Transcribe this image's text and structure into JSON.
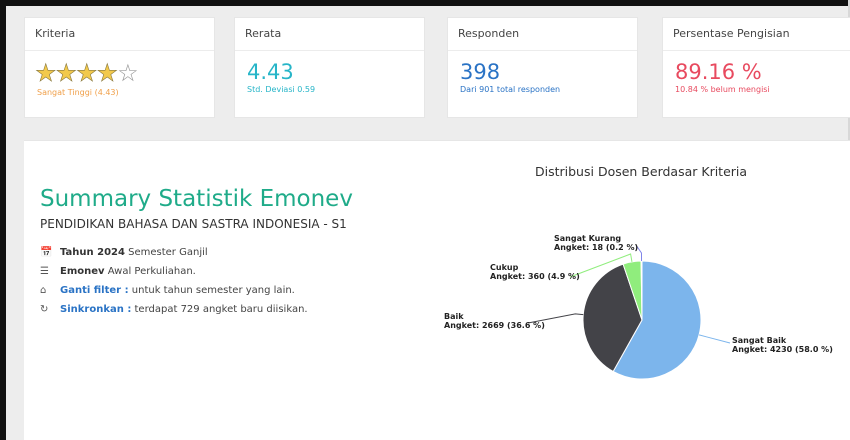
{
  "cards": {
    "kriteria": {
      "title": "Kriteria",
      "rating": 4,
      "rating_max": 5,
      "sub": "Sangat Tinggi (4.43)",
      "sub_color": "#f0a04a",
      "star_color": "#f2c94c"
    },
    "rerata": {
      "title": "Rerata",
      "value": "4.43",
      "sub": "Std. Deviasi 0.59",
      "color": "#27b5c8"
    },
    "responden": {
      "title": "Responden",
      "value": "398",
      "sub": "Dari 901 total responden",
      "color": "#2a73c5"
    },
    "persentase": {
      "title": "Persentase Pengisian",
      "value": "89.16 %",
      "sub": "10.84 % belum mengisi",
      "color": "#e84a5f"
    }
  },
  "summary": {
    "title": "Summary Statistik Emonev",
    "prodi": "PENDIDIKAN BAHASA DAN SASTRA INDONESIA - S1",
    "title_color": "#1fab89",
    "items": [
      {
        "icon": "calendar-icon",
        "bold": "Tahun 2024",
        "text": " Semester Ganjil"
      },
      {
        "icon": "list-icon",
        "bold": "Emonev",
        "text": " Awal Perkuliahan."
      },
      {
        "icon": "home-icon",
        "link": "Ganti filter :",
        "text": " untuk tahun semester yang lain."
      },
      {
        "icon": "refresh-icon",
        "link": "Sinkronkan :",
        "text": " terdapat 729 angket baru diisikan."
      }
    ]
  },
  "chart_data": {
    "type": "pie",
    "title": "Distribusi Dosen Berdasar Kriteria",
    "slices": [
      {
        "name": "Sangat Baik",
        "value": 4230,
        "percent": 58.0,
        "color": "#7cb5ec",
        "label2": "Angket: 4230 (58.0 %)"
      },
      {
        "name": "Baik",
        "value": 2669,
        "percent": 36.6,
        "color": "#434348",
        "label2": "Angket: 2669 (36.6 %)"
      },
      {
        "name": "Cukup",
        "value": 360,
        "percent": 4.9,
        "color": "#90ed7d",
        "label2": "Angket: 360 (4.9 %)"
      },
      {
        "name": "Sangat Kurang",
        "value": 18,
        "percent": 0.2,
        "color": "#8085e9",
        "label2": "Angket: 18 (0.2 %)"
      }
    ]
  }
}
